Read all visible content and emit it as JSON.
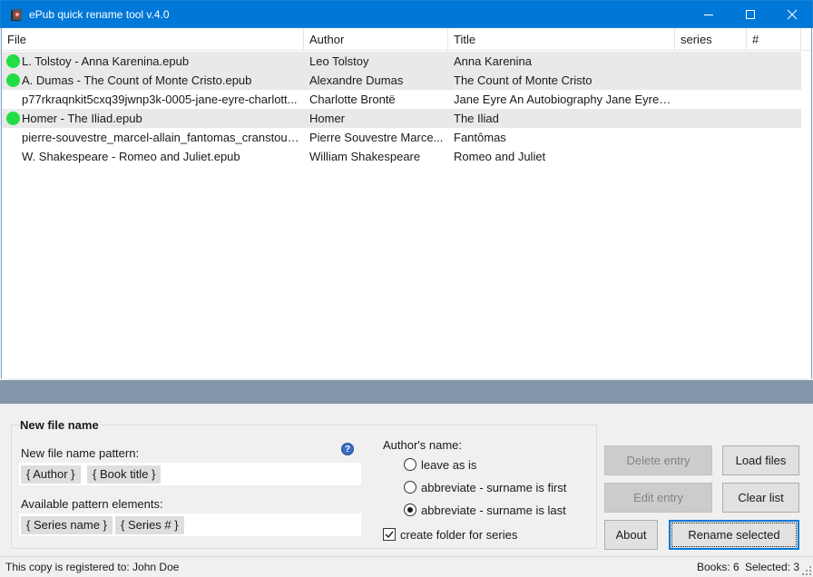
{
  "window": {
    "title": "ePub quick rename tool v.4.0",
    "accent_color": "#0078d7"
  },
  "list": {
    "columns": [
      "File",
      "Author",
      "Title",
      "series",
      "#"
    ],
    "rows": [
      {
        "file": "L. Tolstoy - Anna Karenina.epub",
        "author": "Leo Tolstoy",
        "title": "Anna Karenina",
        "series": "",
        "number": "",
        "selected": true,
        "status": "green-dot"
      },
      {
        "file": "A. Dumas - The Count of Monte Cristo.epub",
        "author": "Alexandre Dumas",
        "title": "The Count of Monte Cristo",
        "series": "",
        "number": "",
        "selected": true,
        "status": "green-dot"
      },
      {
        "file": "p77rkraqnkit5cxq39jwnp3k-0005-jane-eyre-charlott...",
        "author": "Charlotte Brontë",
        "title": "Jane Eyre An Autobiography Jane Eyre:...",
        "series": "",
        "number": "",
        "selected": false,
        "status": ""
      },
      {
        "file": "Homer - The Iliad.epub",
        "author": "Homer",
        "title": "The Iliad",
        "series": "",
        "number": "",
        "selected": true,
        "status": "green-dot"
      },
      {
        "file": "pierre-souvestre_marcel-allain_fantomas_cranstoun...",
        "author": "Pierre Souvestre Marce...",
        "title": "Fantômas",
        "series": "",
        "number": "",
        "selected": false,
        "status": ""
      },
      {
        "file": "W. Shakespeare - Romeo and Juliet.epub",
        "author": "William Shakespeare",
        "title": "Romeo and Juliet",
        "series": "",
        "number": "",
        "selected": false,
        "status": ""
      }
    ]
  },
  "new_file_name": {
    "group_title": "New file name",
    "pattern_label": "New file name pattern:",
    "pattern_chips": [
      "{ Author }",
      "{ Book title }"
    ],
    "available_label": "Available pattern elements:",
    "available_chips": [
      "{ Series name }",
      "{ Series # }"
    ],
    "help_icon": "question-circle-icon"
  },
  "author_name": {
    "label": "Author's name:",
    "options": [
      "leave as is",
      "abbreviate - surname is first",
      "abbreviate - surname is last"
    ],
    "selected_index": 2,
    "folder_checkbox_label": "create folder for series",
    "folder_checked": true
  },
  "buttons": {
    "delete_entry": "Delete entry",
    "load_files": "Load files",
    "edit_entry": "Edit entry",
    "clear_list": "Clear list",
    "about": "About",
    "rename_selected": "Rename selected"
  },
  "status": {
    "registered": "This copy is registered to: John Doe",
    "books": "Books: 6",
    "selected": "Selected: 3"
  }
}
